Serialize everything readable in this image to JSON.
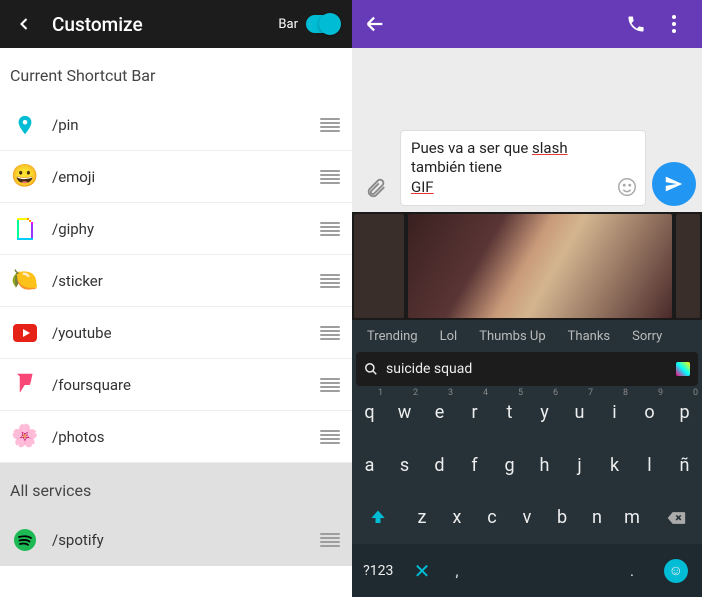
{
  "left": {
    "title": "Customize",
    "bar_label": "Bar",
    "section_current": "Current Shortcut Bar",
    "section_all": "All services",
    "shortcuts": [
      {
        "cmd": "/pin",
        "icon": "pin"
      },
      {
        "cmd": "/emoji",
        "icon": "emoji"
      },
      {
        "cmd": "/giphy",
        "icon": "giphy"
      },
      {
        "cmd": "/sticker",
        "icon": "sticker"
      },
      {
        "cmd": "/youtube",
        "icon": "youtube"
      },
      {
        "cmd": "/foursquare",
        "icon": "foursquare"
      },
      {
        "cmd": "/photos",
        "icon": "photos"
      }
    ],
    "all": [
      {
        "cmd": "/spotify",
        "icon": "spotify"
      }
    ]
  },
  "right": {
    "message": {
      "pre": "Pues va a ser que ",
      "u1": "slash",
      "mid": " también tiene ",
      "u2": "GIF"
    },
    "categories": [
      "Trending",
      "Lol",
      "Thumbs Up",
      "Thanks",
      "Sorry"
    ],
    "search": "suicide squad",
    "keys_row1": [
      {
        "k": "q",
        "n": "1"
      },
      {
        "k": "w",
        "n": "2"
      },
      {
        "k": "e",
        "n": "3"
      },
      {
        "k": "r",
        "n": "4"
      },
      {
        "k": "t",
        "n": "5"
      },
      {
        "k": "y",
        "n": "6"
      },
      {
        "k": "u",
        "n": "7"
      },
      {
        "k": "i",
        "n": "8"
      },
      {
        "k": "o",
        "n": "9"
      },
      {
        "k": "p",
        "n": "0"
      }
    ],
    "keys_row2": [
      "a",
      "s",
      "d",
      "f",
      "g",
      "h",
      "j",
      "k",
      "l",
      "ñ"
    ],
    "keys_row3": [
      "z",
      "x",
      "c",
      "v",
      "b",
      "n",
      "m"
    ],
    "sym_label": "?123",
    "comma": ",",
    "period": "."
  }
}
